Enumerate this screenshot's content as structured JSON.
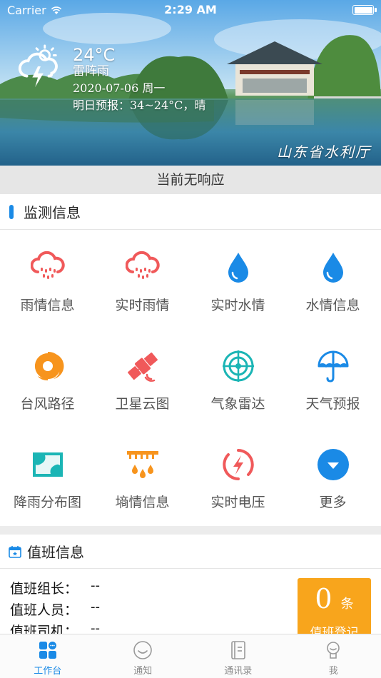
{
  "status_bar": {
    "carrier": "Carrier",
    "time": "2:29 AM"
  },
  "weather": {
    "temperature": "24°C",
    "condition": "雷阵雨",
    "date": "2020-07-06 周一",
    "forecast": "明日预报：34~24°C，晴"
  },
  "banner": {
    "org_name": "山东省水利厅"
  },
  "notice": "当前无响应",
  "monitor": {
    "title": "监测信息",
    "items": [
      {
        "label": "雨情信息",
        "icon": "rain-cloud-icon"
      },
      {
        "label": "实时雨情",
        "icon": "rain-cloud-icon"
      },
      {
        "label": "实时水情",
        "icon": "water-drop-icon"
      },
      {
        "label": "水情信息",
        "icon": "water-drop-icon"
      },
      {
        "label": "台风路径",
        "icon": "typhoon-icon"
      },
      {
        "label": "卫星云图",
        "icon": "satellite-icon"
      },
      {
        "label": "气象雷达",
        "icon": "radar-icon"
      },
      {
        "label": "天气预报",
        "icon": "umbrella-icon"
      },
      {
        "label": "降雨分布图",
        "icon": "map-icon"
      },
      {
        "label": "墒情信息",
        "icon": "soil-moisture-icon"
      },
      {
        "label": "实时电压",
        "icon": "voltage-icon"
      },
      {
        "label": "更多",
        "icon": "more-chevron-icon"
      }
    ]
  },
  "duty": {
    "title": "值班信息",
    "rows": [
      {
        "label": "值班组长：",
        "value": "--"
      },
      {
        "label": "值班人员：",
        "value": "--"
      },
      {
        "label": "值班司机：",
        "value": "--"
      }
    ],
    "register": {
      "count": "0",
      "unit": "条",
      "label": "值班登记"
    }
  },
  "tabs": [
    {
      "label": "工作台",
      "icon": "workbench-icon",
      "active": true
    },
    {
      "label": "通知",
      "icon": "notification-icon",
      "active": false
    },
    {
      "label": "通讯录",
      "icon": "contacts-icon",
      "active": false
    },
    {
      "label": "我",
      "icon": "profile-icon",
      "active": false
    }
  ],
  "colors": {
    "accent": "#1a8ae6",
    "rain_red": "#f0595a",
    "water_blue": "#1a8ae6",
    "typhoon_orange": "#f7941d",
    "radar_teal": "#1bb5b5",
    "register_orange": "#f8a51c"
  }
}
